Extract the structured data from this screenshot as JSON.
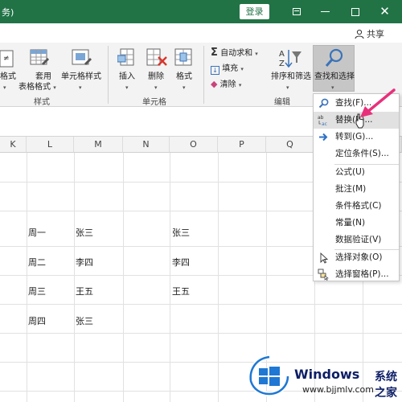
{
  "titlebar": {
    "title_fragment": "务)",
    "login": "登录",
    "share": "共享"
  },
  "ribbon": {
    "format_partial": "格式",
    "styles": {
      "table_format_line1": "套用",
      "table_format_line2": "表格格式",
      "cell_styles": "单元格样式",
      "group_label": "样式"
    },
    "cells": {
      "insert": "插入",
      "delete": "删除",
      "format": "格式",
      "group_label": "单元格"
    },
    "editing": {
      "autosum": "自动求和",
      "fill": "填充",
      "clear": "清除",
      "sort_filter": "排序和筛选",
      "find_select": "查找和选择",
      "group_label": "编辑"
    }
  },
  "grid": {
    "columns": [
      "K",
      "L",
      "M",
      "N",
      "O",
      "P",
      "Q"
    ],
    "cells": {
      "L1": "周一",
      "M1": "张三",
      "O1": "张三",
      "L2": "周二",
      "M2": "李四",
      "O2": "李四",
      "L3": "周三",
      "M3": "王五",
      "O3": "王五",
      "L4": "周四",
      "M4": "张三"
    }
  },
  "menu": {
    "items": [
      {
        "label": "查找(F)...",
        "icon": "search-icon"
      },
      {
        "label": "替换(R)...",
        "icon": "replace-icon",
        "highlighted": true
      },
      {
        "label": "转到(G)...",
        "icon": "arrow-right-icon"
      },
      {
        "label": "定位条件(S)..."
      },
      {
        "label": "公式(U)"
      },
      {
        "label": "批注(M)"
      },
      {
        "label": "条件格式(C)"
      },
      {
        "label": "常量(N)"
      },
      {
        "label": "数据验证(V)"
      },
      {
        "label": "选择对象(O)",
        "icon": "cursor-icon"
      },
      {
        "label": "选择窗格(P)...",
        "icon": "selection-pane-icon"
      }
    ]
  },
  "watermark": {
    "brand": "Windows",
    "brand_cn": "系统之家",
    "url": "www.bjjmlv.com"
  },
  "colors": {
    "excel_green": "#217346",
    "menu_highlight": "#e1e1e1",
    "arrow_pink": "#e8307a",
    "wm_blue": "#0e1f66"
  }
}
